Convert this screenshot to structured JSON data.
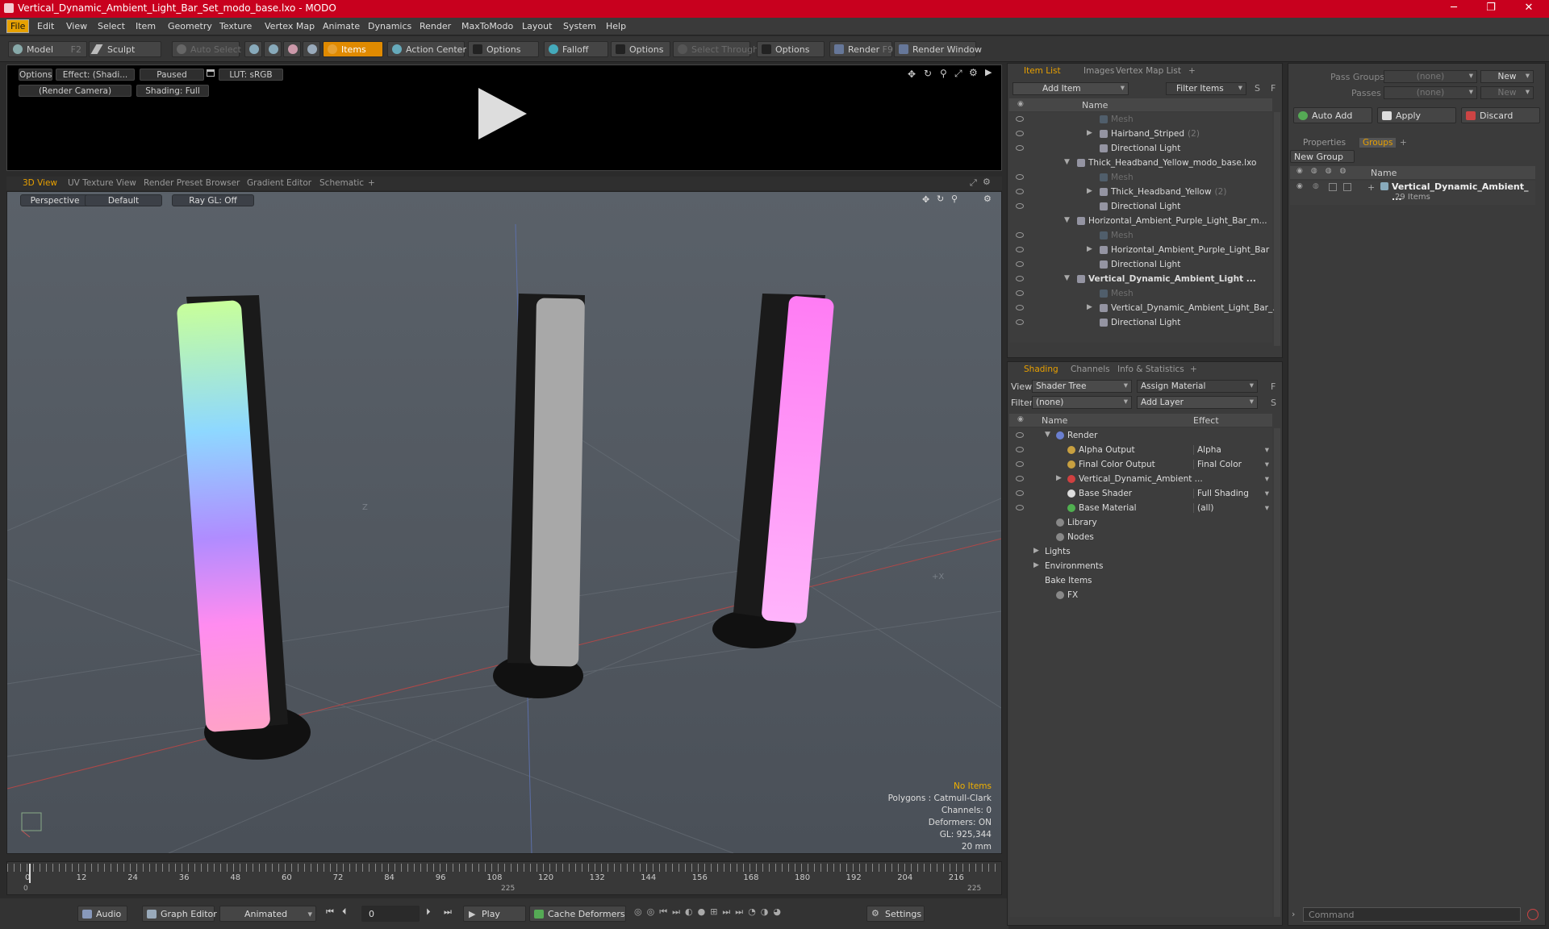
{
  "window": {
    "title": "Vertical_Dynamic_Ambient_Light_Bar_Set_modo_base.lxo - MODO"
  },
  "menu": [
    "File",
    "Edit",
    "View",
    "Select",
    "Item",
    "Geometry",
    "Texture",
    "Vertex Map",
    "Animate",
    "Dynamics",
    "Render",
    "MaxToModo",
    "Layout",
    "System",
    "Help"
  ],
  "toolbar": {
    "model": "Model",
    "model_key": "F2",
    "sculpt": "Sculpt",
    "auto_select": "Auto Select",
    "items": "Items",
    "action_center": "Action Center",
    "options1": "Options",
    "falloff": "Falloff",
    "options2": "Options",
    "select_through": "Select Through",
    "options3": "Options",
    "render": "Render",
    "render_key": "F9",
    "render_window": "Render Window"
  },
  "preview": {
    "options": "Options",
    "effect": "Effect: (Shadi...",
    "paused": "Paused",
    "lut": "LUT: sRGB",
    "camera": "(Render Camera)",
    "shading": "Shading: Full"
  },
  "view_tabs": [
    "3D View",
    "UV Texture View",
    "Render Preset Browser",
    "Gradient Editor",
    "Schematic",
    "+"
  ],
  "viewport": {
    "projection": "Perspective",
    "style": "Default",
    "raygl": "Ray GL: Off",
    "axis_z": "Z",
    "axis_x": "+X",
    "info": {
      "selection": "No Items",
      "polygons": "Polygons : Catmull-Clark",
      "channels": "Channels: 0",
      "deformers": "Deformers: ON",
      "gl": "GL: 925,344",
      "unit": "20 mm"
    }
  },
  "timeline": {
    "ticks": [
      "0",
      "12",
      "24",
      "36",
      "48",
      "60",
      "72",
      "84",
      "96",
      "108",
      "120",
      "132",
      "144",
      "156",
      "168",
      "180",
      "192",
      "204",
      "216"
    ],
    "start": "0",
    "mid": "225",
    "end": "225"
  },
  "bottom": {
    "audio": "Audio",
    "graph_editor": "Graph Editor",
    "animated": "Animated",
    "frame": "0",
    "play": "Play",
    "cache": "Cache Deformers",
    "settings": "Settings"
  },
  "item_list": {
    "tabs": [
      "Item List",
      "Images",
      "Vertex Map List",
      "+"
    ],
    "add_item": "Add Item",
    "filter": "Filter Items",
    "s": "S",
    "f": "F",
    "col_name": "Name",
    "rows": [
      {
        "label": "Mesh",
        "indent": 3,
        "dim": true,
        "eye": true
      },
      {
        "label": "Hairband_Striped",
        "count": "(2)",
        "indent": 3,
        "expander": true,
        "eye": true
      },
      {
        "label": "Directional Light",
        "indent": 3,
        "eye": true
      },
      {
        "label": "Thick_Headband_Yellow_modo_base.lxo",
        "indent": 1,
        "expander": true,
        "open": true
      },
      {
        "label": "Mesh",
        "indent": 3,
        "dim": true,
        "eye": true
      },
      {
        "label": "Thick_Headband_Yellow",
        "count": "(2)",
        "indent": 3,
        "expander": true,
        "eye": true
      },
      {
        "label": "Directional Light",
        "indent": 3,
        "eye": true
      },
      {
        "label": "Horizontal_Ambient_Purple_Light_Bar_m...",
        "indent": 1,
        "expander": true,
        "open": true
      },
      {
        "label": "Mesh",
        "indent": 3,
        "dim": true,
        "eye": true
      },
      {
        "label": "Horizontal_Ambient_Purple_Light_Bar",
        "indent": 3,
        "expander": true,
        "eye": true
      },
      {
        "label": "Directional Light",
        "indent": 3,
        "eye": true
      },
      {
        "label": "Vertical_Dynamic_Ambient_Light ...",
        "indent": 1,
        "expander": true,
        "open": true,
        "bold": true,
        "eye": true
      },
      {
        "label": "Mesh",
        "indent": 3,
        "dim": true,
        "eye": true
      },
      {
        "label": "Vertical_Dynamic_Ambient_Light_Bar_...",
        "indent": 3,
        "expander": true,
        "eye": true
      },
      {
        "label": "Directional Light",
        "indent": 3,
        "eye": true
      }
    ]
  },
  "shading": {
    "tabs": [
      "Shading",
      "Channels",
      "Info & Statistics",
      "+"
    ],
    "view_label": "View",
    "view_value": "Shader Tree",
    "assign": "Assign Material",
    "f": "F",
    "filter_label": "Filter",
    "filter_value": "(none)",
    "add_layer": "Add Layer",
    "s": "S",
    "col_name": "Name",
    "col_effect": "Effect",
    "rows": [
      {
        "label": "Render",
        "indent": 1,
        "open": true,
        "eye": true,
        "icon": "#6a7fd0"
      },
      {
        "label": "Alpha Output",
        "effect": "Alpha",
        "indent": 2,
        "eye": true,
        "icon": "#c8a040"
      },
      {
        "label": "Final Color Output",
        "effect": "Final Color",
        "indent": 2,
        "eye": true,
        "icon": "#c8a040"
      },
      {
        "label": "Vertical_Dynamic_Ambient ...",
        "effect": "",
        "indent": 2,
        "expander": true,
        "eye": true,
        "icon": "#d04040"
      },
      {
        "label": "Base Shader",
        "effect": "Full Shading",
        "indent": 2,
        "eye": true,
        "icon": "#dddddd"
      },
      {
        "label": "Base Material",
        "effect": "(all)",
        "indent": 2,
        "eye": true,
        "icon": "#50b050"
      },
      {
        "label": "Library",
        "indent": 1,
        "icon": "#888"
      },
      {
        "label": "Nodes",
        "indent": 1,
        "icon": "#888"
      },
      {
        "label": "Lights",
        "indent": 0,
        "expander": true
      },
      {
        "label": "Environments",
        "indent": 0,
        "expander": true
      },
      {
        "label": "Bake Items",
        "indent": 0
      },
      {
        "label": "FX",
        "indent": 1,
        "icon": "#888"
      }
    ]
  },
  "right": {
    "pass_groups": "Pass Groups",
    "passes": "Passes",
    "none": "(none)",
    "new": "New",
    "auto_add": "Auto Add",
    "apply": "Apply",
    "discard": "Discard",
    "tabs": [
      "Properties",
      "Groups",
      "+"
    ],
    "new_group": "New Group",
    "col_name": "Name",
    "group_name": "Vertical_Dynamic_Ambient_ ...",
    "group_count": "29 Items",
    "command": "Command"
  },
  "colors": {
    "title": "#c8001e",
    "accent": "#e8a000"
  }
}
